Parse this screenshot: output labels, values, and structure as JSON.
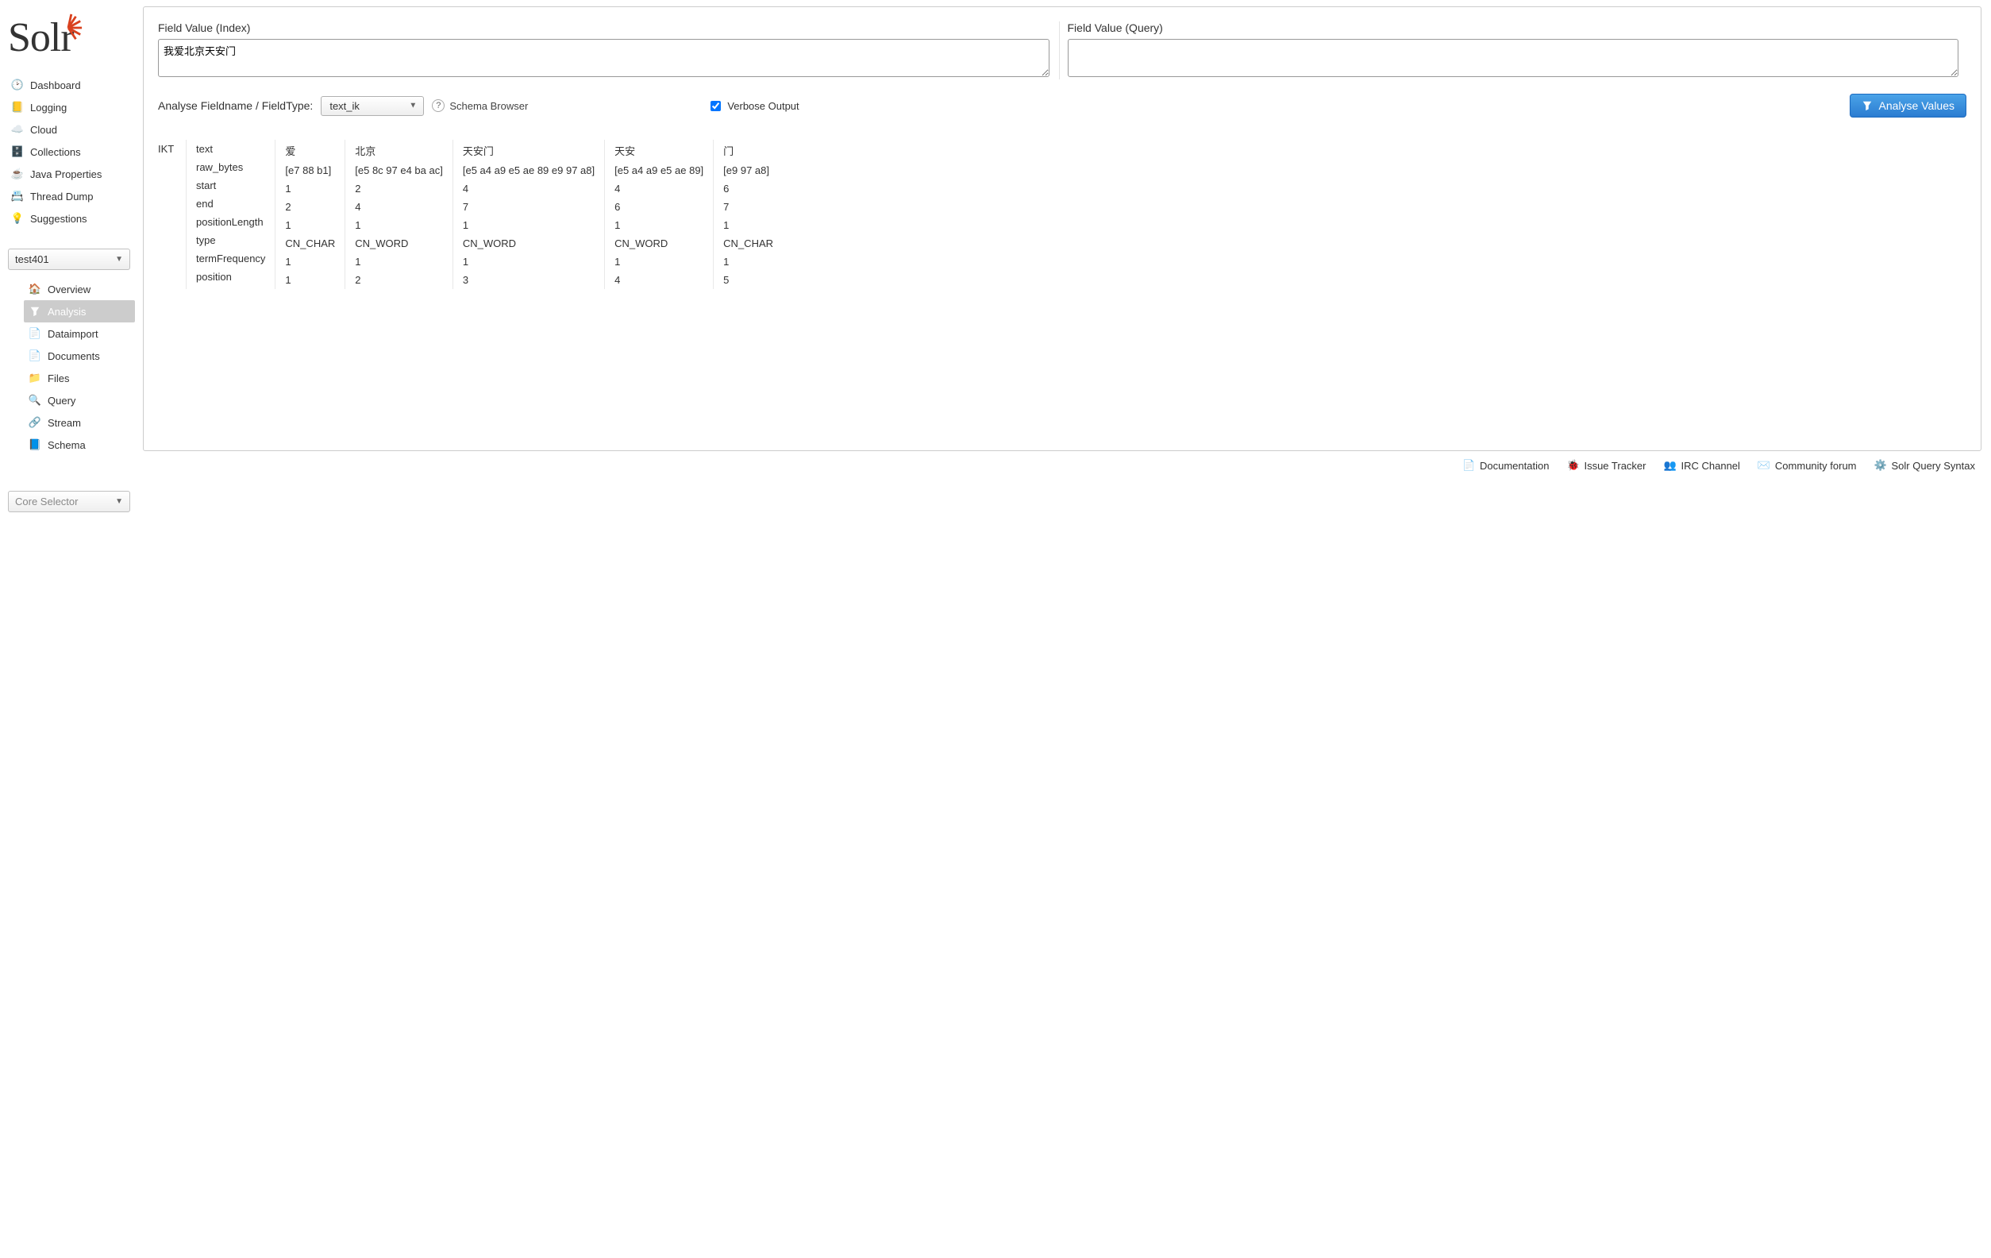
{
  "logo_text": "Solr",
  "nav": {
    "items": [
      {
        "label": "Dashboard"
      },
      {
        "label": "Logging"
      },
      {
        "label": "Cloud"
      },
      {
        "label": "Collections"
      },
      {
        "label": "Java Properties"
      },
      {
        "label": "Thread Dump"
      },
      {
        "label": "Suggestions"
      }
    ]
  },
  "collection_select": "test401",
  "core_select": "Core Selector",
  "subnav": {
    "items": [
      {
        "label": "Overview"
      },
      {
        "label": "Analysis",
        "active": true
      },
      {
        "label": "Dataimport"
      },
      {
        "label": "Documents"
      },
      {
        "label": "Files"
      },
      {
        "label": "Query"
      },
      {
        "label": "Stream"
      },
      {
        "label": "Schema"
      }
    ]
  },
  "analysis": {
    "index_label": "Field Value (Index)",
    "index_value": "我爱北京天安门",
    "query_label": "Field Value (Query)",
    "query_value": "",
    "fieldtype_label": "Analyse Fieldname / FieldType:",
    "fieldtype_value": "text_ik",
    "schema_browser": "Schema Browser",
    "verbose_label": "Verbose Output",
    "verbose_checked": true,
    "button_label": "Analyse Values",
    "ikt_label": "IKT",
    "row_labels": [
      "text",
      "raw_bytes",
      "start",
      "end",
      "positionLength",
      "type",
      "termFrequency",
      "position"
    ],
    "tokens": [
      {
        "text": "爱",
        "raw_bytes": "[e7 88 b1]",
        "start": "1",
        "end": "2",
        "positionLength": "1",
        "type": "CN_CHAR",
        "termFrequency": "1",
        "position": "1"
      },
      {
        "text": "北京",
        "raw_bytes": "[e5 8c 97 e4 ba ac]",
        "start": "2",
        "end": "4",
        "positionLength": "1",
        "type": "CN_WORD",
        "termFrequency": "1",
        "position": "2"
      },
      {
        "text": "天安门",
        "raw_bytes": "[e5 a4 a9 e5 ae 89 e9 97 a8]",
        "start": "4",
        "end": "7",
        "positionLength": "1",
        "type": "CN_WORD",
        "termFrequency": "1",
        "position": "3"
      },
      {
        "text": "天安",
        "raw_bytes": "[e5 a4 a9 e5 ae 89]",
        "start": "4",
        "end": "6",
        "positionLength": "1",
        "type": "CN_WORD",
        "termFrequency": "1",
        "position": "4"
      },
      {
        "text": "门",
        "raw_bytes": "[e9 97 a8]",
        "start": "6",
        "end": "7",
        "positionLength": "1",
        "type": "CN_CHAR",
        "termFrequency": "1",
        "position": "5"
      }
    ]
  },
  "footer": {
    "links": [
      {
        "label": "Documentation"
      },
      {
        "label": "Issue Tracker"
      },
      {
        "label": "IRC Channel"
      },
      {
        "label": "Community forum"
      },
      {
        "label": "Solr Query Syntax"
      }
    ]
  }
}
